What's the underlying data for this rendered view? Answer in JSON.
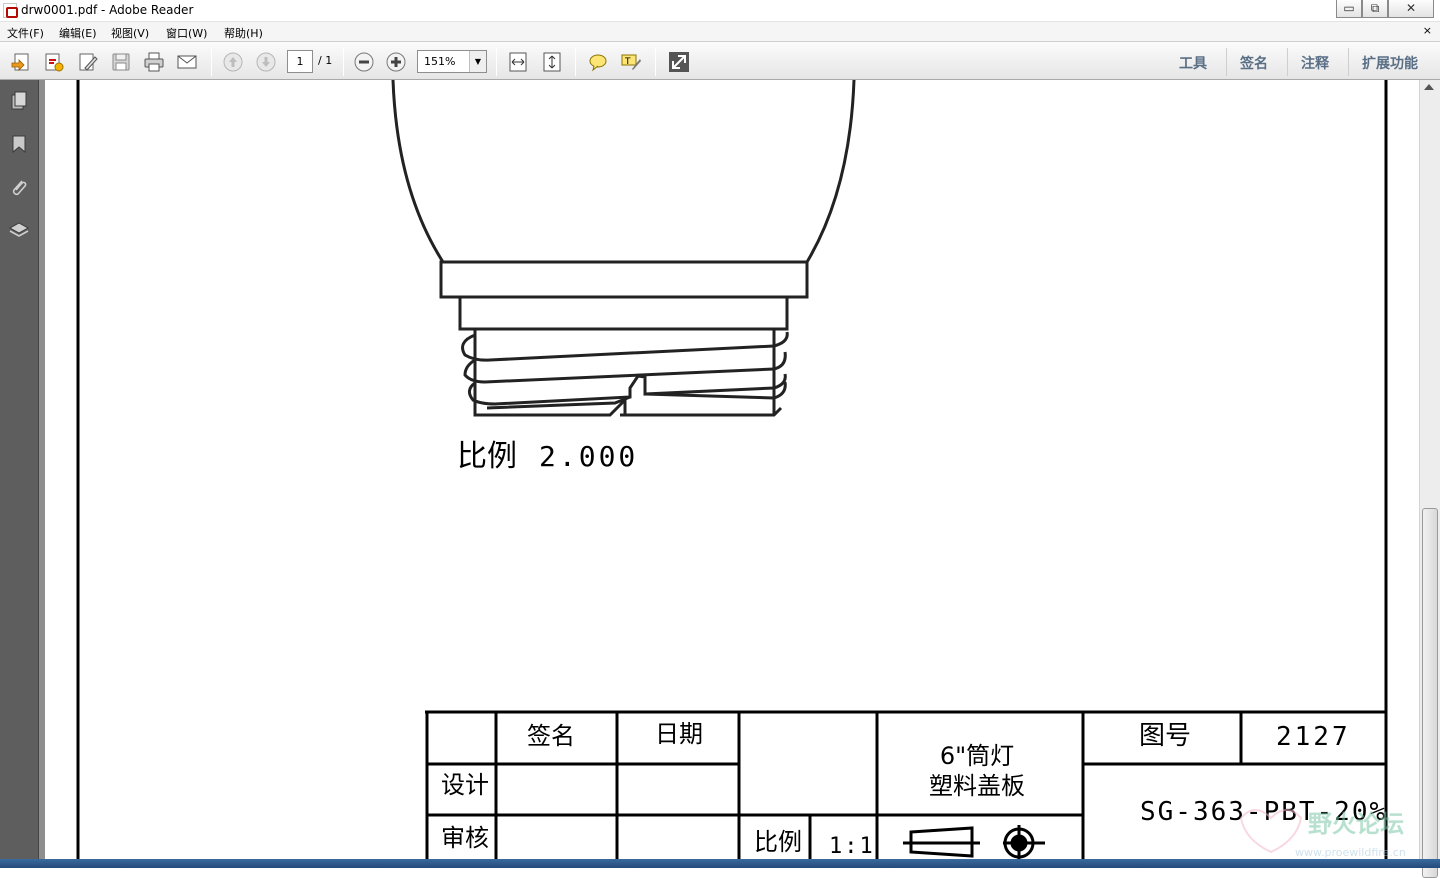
{
  "window": {
    "title": "drw0001.pdf - Adobe Reader",
    "controls": {
      "minimize": "▭",
      "restore": "⧉",
      "close": "✕"
    }
  },
  "menu": {
    "items": [
      "文件(F)",
      "编辑(E)",
      "视图(V)",
      "窗口(W)",
      "帮助(H)"
    ],
    "close_doc": "×"
  },
  "toolbar": {
    "page_current": "1",
    "page_total": "/ 1",
    "zoom": "151%",
    "right_links": [
      "工具",
      "签名",
      "注释",
      "扩展功能"
    ]
  },
  "drawing": {
    "scale_label": "比例",
    "scale_value": "2.000",
    "title_block": {
      "col_sign": "签名",
      "col_date": "日期",
      "row_design": "设计",
      "row_review": "审核",
      "product_line1": "6\"筒灯",
      "product_line2": "塑料盖板",
      "drawing_no_label": "图号",
      "drawing_no": "2127",
      "material": "SG-363-PBT-20%",
      "scale_label": "比例",
      "scale_value": "1:1"
    }
  },
  "watermark": {
    "name": "野火论坛",
    "url": "www.proewildfire.cn"
  }
}
